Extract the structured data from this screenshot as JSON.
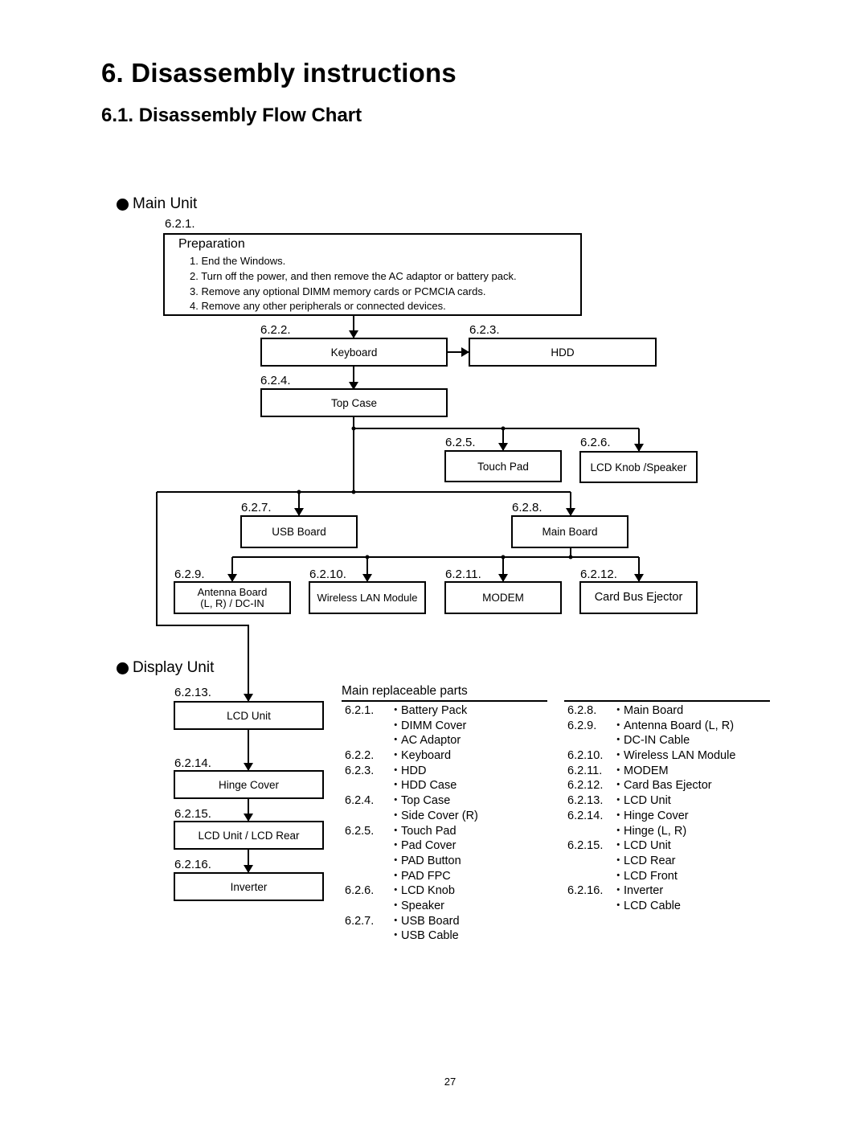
{
  "title": "6. Disassembly instructions",
  "subtitle": "6.1. Disassembly Flow Chart",
  "sections": {
    "main_unit": "Main Unit",
    "display_unit": "Display Unit"
  },
  "preparation": {
    "number": "6.2.1.",
    "title": "Preparation",
    "steps": [
      "1. End the Windows.",
      "2. Turn off the power, and then remove the AC adaptor or battery pack.",
      "3. Remove any optional DIMM memory cards or PCMCIA cards.",
      "4. Remove any other peripherals or connected devices."
    ]
  },
  "nodes": {
    "keyboard": {
      "number": "6.2.2.",
      "label": "Keyboard"
    },
    "hdd": {
      "number": "6.2.3.",
      "label": "HDD"
    },
    "top_case": {
      "number": "6.2.4.",
      "label": "Top Case"
    },
    "touch_pad": {
      "number": "6.2.5.",
      "label": "Touch Pad"
    },
    "lcd_knob_speaker": {
      "number": "6.2.6.",
      "label": "LCD Knob /Speaker"
    },
    "usb_board": {
      "number": "6.2.7.",
      "label": "USB Board"
    },
    "main_board": {
      "number": "6.2.8.",
      "label": "Main Board"
    },
    "antenna_board": {
      "number": "6.2.9.",
      "label_line1": "Antenna Board",
      "label_line2": "(L, R) / DC-IN"
    },
    "wireless_lan": {
      "number": "6.2.10.",
      "label": "Wireless LAN Module"
    },
    "modem": {
      "number": "6.2.11.",
      "label": "MODEM"
    },
    "card_bus_ejector": {
      "number": "6.2.12.",
      "label": "Card Bus Ejector"
    },
    "lcd_unit": {
      "number": "6.2.13.",
      "label": "LCD Unit"
    },
    "hinge_cover": {
      "number": "6.2.14.",
      "label": "Hinge Cover"
    },
    "lcd_unit_rear": {
      "number": "6.2.15.",
      "label": "LCD Unit / LCD Rear"
    },
    "inverter": {
      "number": "6.2.16.",
      "label": "Inverter"
    }
  },
  "edges": [
    [
      "preparation",
      "keyboard"
    ],
    [
      "keyboard",
      "hdd"
    ],
    [
      "keyboard",
      "top_case"
    ],
    [
      "top_case",
      "touch_pad"
    ],
    [
      "top_case",
      "lcd_knob_speaker"
    ],
    [
      "top_case",
      "usb_board"
    ],
    [
      "top_case",
      "main_board"
    ],
    [
      "top_case",
      "lcd_unit"
    ],
    [
      "main_board",
      "antenna_board"
    ],
    [
      "main_board",
      "wireless_lan"
    ],
    [
      "main_board",
      "modem"
    ],
    [
      "main_board",
      "card_bus_ejector"
    ],
    [
      "lcd_unit",
      "hinge_cover"
    ],
    [
      "hinge_cover",
      "lcd_unit_rear"
    ],
    [
      "lcd_unit_rear",
      "inverter"
    ]
  ],
  "parts": {
    "heading": "Main replaceable parts",
    "bullet": "・",
    "left": [
      {
        "num": "6.2.1.",
        "item": "Battery Pack"
      },
      {
        "num": "",
        "item": "DIMM Cover"
      },
      {
        "num": "",
        "item": "AC Adaptor"
      },
      {
        "num": "6.2.2.",
        "item": "Keyboard"
      },
      {
        "num": "6.2.3.",
        "item": "HDD"
      },
      {
        "num": "",
        "item": "HDD Case"
      },
      {
        "num": "6.2.4.",
        "item": "Top Case"
      },
      {
        "num": "",
        "item": "Side Cover (R)"
      },
      {
        "num": "6.2.5.",
        "item": "Touch Pad"
      },
      {
        "num": "",
        "item": "Pad Cover"
      },
      {
        "num": "",
        "item": "PAD Button"
      },
      {
        "num": "",
        "item": "PAD FPC"
      },
      {
        "num": "6.2.6.",
        "item": "LCD Knob"
      },
      {
        "num": "",
        "item": "Speaker"
      },
      {
        "num": "6.2.7.",
        "item": "USB Board"
      },
      {
        "num": "",
        "item": "USB Cable"
      }
    ],
    "right": [
      {
        "num": "6.2.8.",
        "item": "Main Board"
      },
      {
        "num": "6.2.9.",
        "item": "Antenna Board (L, R)"
      },
      {
        "num": "",
        "item": "DC-IN Cable"
      },
      {
        "num": "6.2.10.",
        "item": "Wireless LAN Module"
      },
      {
        "num": "6.2.11.",
        "item": "MODEM"
      },
      {
        "num": "6.2.12.",
        "item": "Card Bas Ejector"
      },
      {
        "num": "6.2.13.",
        "item": "LCD Unit"
      },
      {
        "num": "6.2.14.",
        "item": "Hinge Cover"
      },
      {
        "num": "",
        "item": "Hinge (L, R)"
      },
      {
        "num": "6.2.15.",
        "item": "LCD Unit"
      },
      {
        "num": "",
        "item": "LCD Rear"
      },
      {
        "num": "",
        "item": "LCD Front"
      },
      {
        "num": "6.2.16.",
        "item": "Inverter"
      },
      {
        "num": "",
        "item": "LCD Cable"
      }
    ]
  },
  "page_number": "27"
}
